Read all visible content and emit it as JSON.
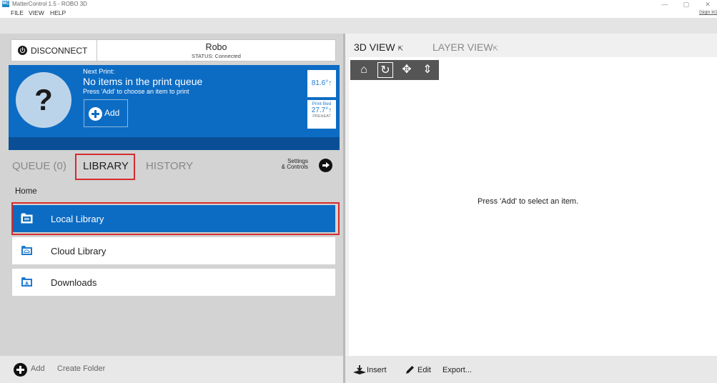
{
  "window": {
    "title": "MatterControl 1.5 - ROBO 3D",
    "app_icon_text": "MC"
  },
  "menu": {
    "items": [
      "FILE",
      "VIEW",
      "HELP"
    ],
    "sign_in": "(sign in)"
  },
  "printer": {
    "disconnect_label": "DISCONNECT",
    "name": "Robo",
    "status": "STATUS: Connected"
  },
  "print_queue": {
    "placeholder_icon": "?",
    "next_print_label": "Next Print:",
    "title": "No items in the print queue",
    "hint": "Press 'Add' to choose an item to print",
    "add_label": "Add",
    "extruder_temp": "81.6°↑",
    "bed_label": "Print Bed",
    "bed_temp": "27.7°↑",
    "preheat_label": "PREHEAT"
  },
  "tabs": {
    "queue": "QUEUE (0)",
    "library": "LIBRARY",
    "history": "HISTORY",
    "settings_line1": "Settings",
    "settings_line2": "& Controls",
    "active": "LIBRARY"
  },
  "library": {
    "breadcrumb": "Home",
    "items": [
      {
        "label": "Local Library",
        "icon": "folder-list-icon",
        "selected": true
      },
      {
        "label": "Cloud Library",
        "icon": "folder-cloud-icon",
        "selected": false
      },
      {
        "label": "Downloads",
        "icon": "folder-download-icon",
        "selected": false
      }
    ]
  },
  "left_footer": {
    "add_label": "Add",
    "create_folder_label": "Create Folder"
  },
  "view": {
    "tab_3d": "3D VIEW",
    "tab_layer": "LAYER VIEW",
    "empty_message": "Press 'Add' to select an item.",
    "tools": [
      "home-icon",
      "rotate-icon",
      "move-icon",
      "zoom-icon"
    ]
  },
  "right_footer": {
    "insert_label": "Insert",
    "edit_label": "Edit",
    "export_label": "Export..."
  },
  "colors": {
    "accent_blue": "#0c6cc4",
    "highlight_red": "#d62c2c"
  }
}
